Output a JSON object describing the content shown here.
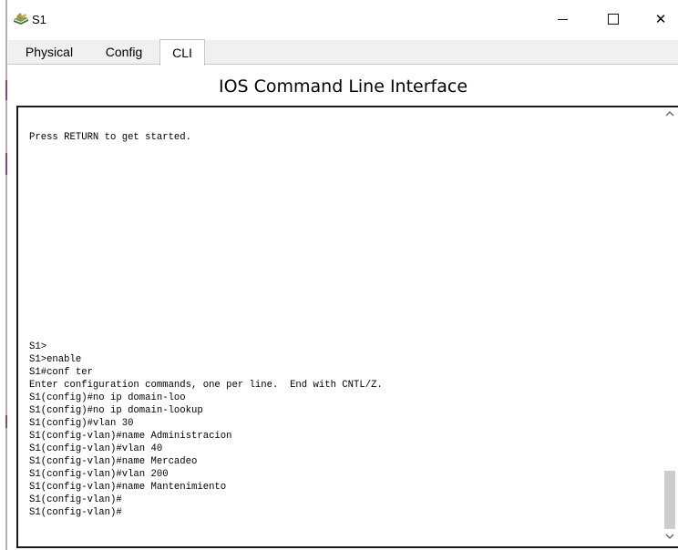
{
  "window": {
    "title": "S1",
    "controls": {
      "minimize": "–",
      "maximize": "☐",
      "close": "✕"
    }
  },
  "tabs": [
    {
      "label": "Physical",
      "active": false
    },
    {
      "label": "Config",
      "active": false
    },
    {
      "label": "CLI",
      "active": true
    }
  ],
  "heading": "IOS Command Line Interface",
  "console": {
    "lines": [
      "Press RETURN to get started.",
      "S1>",
      "S1>enable",
      "S1#conf ter",
      "Enter configuration commands, one per line.  End with CNTL/Z.",
      "S1(config)#no ip domain-loo",
      "S1(config)#no ip domain-lookup",
      "S1(config)#vlan 30",
      "S1(config-vlan)#name Administracion",
      "S1(config-vlan)#vlan 40",
      "S1(config-vlan)#name Mercadeo",
      "S1(config-vlan)#vlan 200",
      "S1(config-vlan)#name Mantenimiento",
      "S1(config-vlan)#",
      "S1(config-vlan)#"
    ]
  },
  "colors": {
    "tab_bar": "#f0f0f0",
    "terminal_border": "#1a1a1a",
    "scroll_thumb": "#cdcdcd"
  },
  "icons": {
    "app": "router-switch-icon",
    "scroll_up": "chevron-up-icon",
    "scroll_down": "chevron-down-icon"
  }
}
